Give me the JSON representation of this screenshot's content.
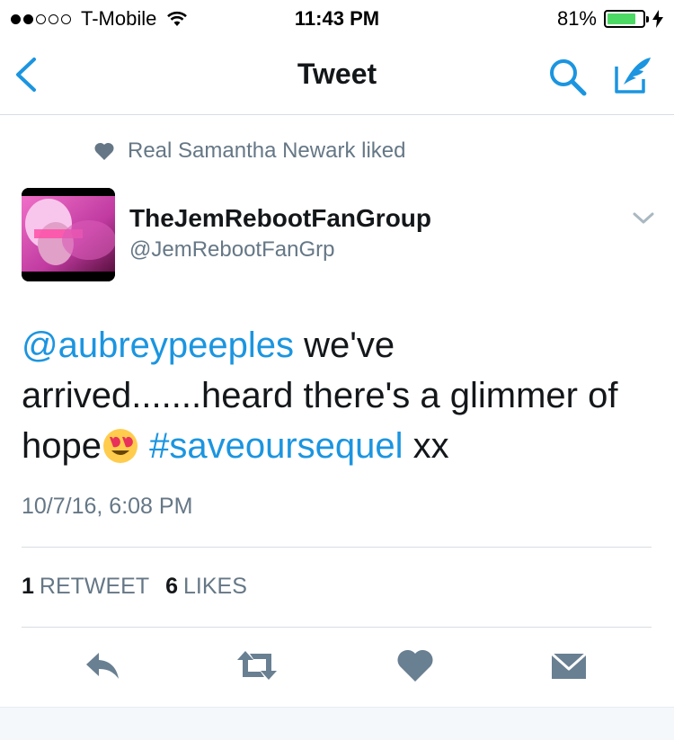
{
  "status_bar": {
    "carrier": "T-Mobile",
    "time": "11:43 PM",
    "battery": "81%",
    "battery_level": 0.81
  },
  "nav": {
    "title": "Tweet"
  },
  "context": {
    "text": "Real Samantha Newark liked"
  },
  "author": {
    "name": "TheJemRebootFanGroup",
    "handle": "@JemRebootFanGrp"
  },
  "tweet": {
    "mention": "@aubreypeeples",
    "text_1": " we've arrived.......heard there's a glimmer of hope",
    "hashtag": "#saveoursequel",
    "text_2": " xx",
    "timestamp": "10/7/16, 6:08 PM"
  },
  "stats": {
    "retweets_count": "1",
    "retweets_label": "RETWEET",
    "likes_count": "6",
    "likes_label": "LIKES"
  },
  "colors": {
    "link": "#1b95e0",
    "secondary_text": "#657786",
    "action_icon": "#697f92"
  }
}
